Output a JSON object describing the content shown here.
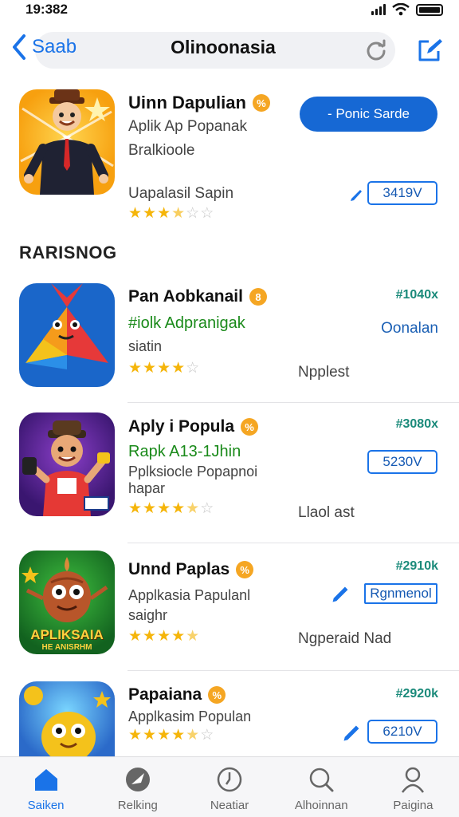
{
  "status": {
    "time": "19:382"
  },
  "nav": {
    "back_label": "Saab",
    "title": "Olinoonasia"
  },
  "featured": {
    "title": "Uinn Dapulian",
    "badge": "%",
    "subtitle1": "Aplik Ap Popanak",
    "subtitle2": "Bralkioole",
    "developer": "Uapalasil Sapin",
    "rating_stars": 3.5,
    "cta_label": "- Ponic Sarde",
    "price": "3419V"
  },
  "section_title": "RARISNOG",
  "rows": [
    {
      "title": "Pan Aobkanail",
      "badge": "8",
      "subtitle1": "#iolk Adpranigak",
      "subtitle2": "siatin",
      "rating_stars": 4,
      "price": "#1040x",
      "link": "Oonalan",
      "status": "Npplest"
    },
    {
      "title": "Aply i Popula",
      "badge": "%",
      "subtitle1": "Rapk A13-1Jhin",
      "subtitle2": "Pplksiocle Popapnoi",
      "subtitle3": "hapar",
      "rating_stars": 4.5,
      "price": "#3080x",
      "button": "5230V",
      "status": "Llaol ast"
    },
    {
      "title": "Unnd Paplas",
      "badge": "%",
      "subtitle1": "Applkasia Papulanl",
      "subtitle2": "saighr",
      "rating_stars": 4.5,
      "price": "#2910k",
      "button": "Rgnmenol",
      "status": "Ngperaid Nad",
      "icon_caption1": "APLIKSAIA",
      "icon_caption2": "HE ANISRHM"
    },
    {
      "title": "Papaiana",
      "badge": "%",
      "subtitle1": "Applkasim Populan",
      "rating_stars": 4.5,
      "price": "#2920k",
      "button": "6210V"
    }
  ],
  "tabs": [
    {
      "label": "Saiken",
      "icon": "home-icon",
      "active": true
    },
    {
      "label": "Relking",
      "icon": "rocket-icon",
      "active": false
    },
    {
      "label": "Neatiar",
      "icon": "clock-icon",
      "active": false
    },
    {
      "label": "Alhoinnan",
      "icon": "search-icon",
      "active": false
    },
    {
      "label": "Paigina",
      "icon": "person-icon",
      "active": false
    }
  ],
  "colors": {
    "accent": "#1a73e8",
    "star": "#f5b50a",
    "price_green": "#1a8a7a"
  }
}
